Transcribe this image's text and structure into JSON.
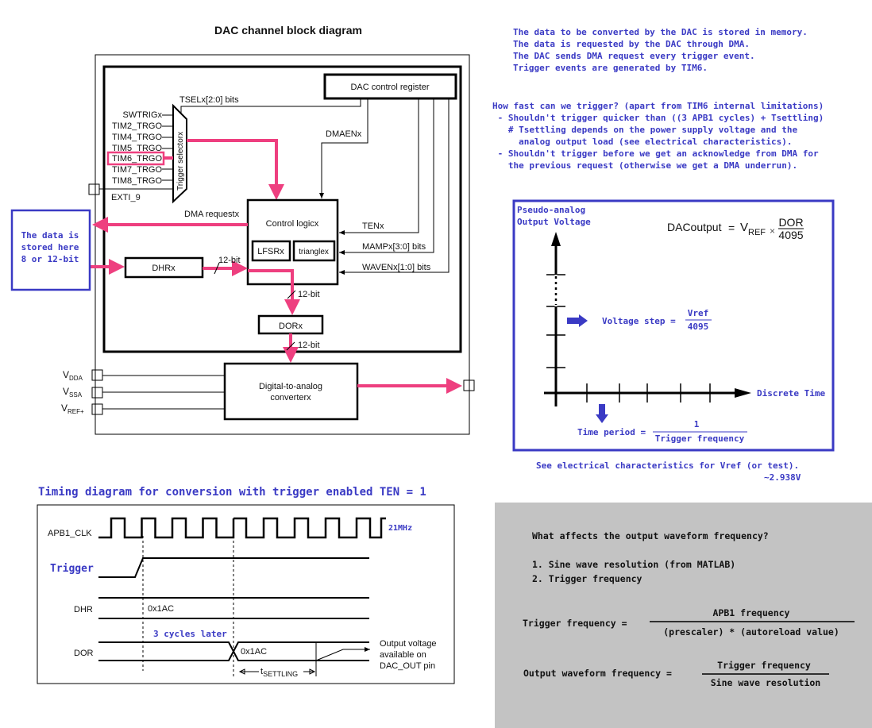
{
  "block_diagram": {
    "title": "DAC channel block diagram",
    "control_register": "DAC control register",
    "tsel_label": "TSELx[2:0] bits",
    "trigger_selector": "Trigger selectorx",
    "trigger_inputs": [
      "SWTRIGx",
      "TIM2_TRGO",
      "TIM4_TRGO",
      "TIM5_TRGO",
      "TIM6_TRGO",
      "TIM7_TRGO",
      "TIM8_TRGO"
    ],
    "exti": "EXTI_9",
    "dmaen": "DMAENx",
    "dma_request": "DMA requestx",
    "control_logic": "Control logicx",
    "lfsr": "LFSRx",
    "triangle": "trianglex",
    "ten": "TENx",
    "mamp": "MAMPx[3:0] bits",
    "waven": "WAVENx[1:0] bits",
    "dhr": "DHRx",
    "dor": "DORx",
    "bit12": "12-bit",
    "dac_line1": "Digital-to-analog",
    "dac_line2": "converterx",
    "supplies": [
      {
        "main": "V",
        "sub": "DDA"
      },
      {
        "main": "V",
        "sub": "SSA"
      },
      {
        "main": "V",
        "sub": "REF+"
      }
    ],
    "note": [
      "The data is",
      "stored here",
      "8 or 12-bit"
    ],
    "highlight_color": "#ee3f7f"
  },
  "notes_top": [
    "The data to be converted by the DAC is stored in memory.",
    "The data is requested by the DAC through DMA.",
    "The DAC sends DMA request every trigger event.",
    "Trigger events are generated by TIM6."
  ],
  "notes_trigger": [
    "How fast can we trigger? (apart from TIM6 internal limitations)",
    " - Shouldn't trigger quicker than ((3 APB1 cycles) + Tsettling)",
    "   # Tsettling depends on the power supply voltage and the",
    "     analog output load (see electrical characteristics).",
    " - Shouldn't trigger before we get an acknowledge from DMA for",
    "   the previous request (otherwise we get a DMA underrun)."
  ],
  "graph": {
    "y_label": [
      "Pseudo-analog",
      "Output Voltage"
    ],
    "x_label": "Discrete Time",
    "formula_lhs": "DACoutput",
    "formula_eq": "=",
    "formula_v": "V",
    "formula_vsub": "REF",
    "formula_times": "×",
    "formula_num": "DOR",
    "formula_den": "4095",
    "voltage_step": "Voltage step =",
    "vs_num": "Vref",
    "vs_den": "4095",
    "time_period": "Time period =",
    "tp_num": "1",
    "tp_den": "Trigger frequency",
    "footnote": "See electrical characteristics for Vref (or test).",
    "vref_value": "~2.938V",
    "accent": "#3a3ac4"
  },
  "timing": {
    "title": "Timing diagram for conversion with trigger enabled TEN = 1",
    "clk": "APB1_CLK",
    "freq": "21MHz",
    "trigger": "Trigger",
    "dhr": "DHR",
    "dhr_value": "0x1AC",
    "later": "3 cycles later",
    "dor": "DOR",
    "dor_value": "0x1AC",
    "t": "t",
    "settling": "SETTLING",
    "output_note": [
      "Output voltage",
      "available on",
      "DAC_OUT pin"
    ]
  },
  "frequency_box": {
    "question": "What affects the output waveform frequency?",
    "items": [
      "1. Sine wave resolution (from MATLAB)",
      "2. Trigger frequency"
    ],
    "f1_lhs": "Trigger frequency =",
    "f1_num": "APB1 frequency",
    "f1_den": "(prescaler) * (autoreload value)",
    "f2_lhs": "Output waveform frequency =",
    "f2_num": "Trigger frequency",
    "f2_den": "Sine wave resolution",
    "background": "#c3c3c3"
  }
}
